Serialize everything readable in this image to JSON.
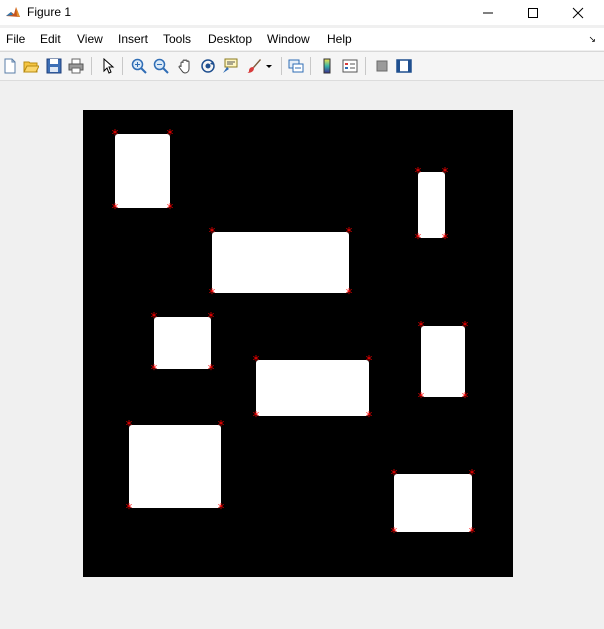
{
  "window": {
    "title": "Figure 1",
    "minimize_glyph": "—",
    "maximize_glyph": "☐",
    "close_glyph": "✕"
  },
  "menu": {
    "items": [
      "File",
      "Edit",
      "View",
      "Insert",
      "Tools",
      "Desktop",
      "Window",
      "Help"
    ],
    "overflow_glyph": "↘"
  },
  "toolbar": {
    "buttons": [
      {
        "name": "new-figure-icon"
      },
      {
        "name": "open-file-icon"
      },
      {
        "name": "save-icon"
      },
      {
        "name": "print-icon"
      },
      {
        "name": "edit-plot-pointer-icon"
      },
      {
        "name": "zoom-in-icon"
      },
      {
        "name": "zoom-out-icon"
      },
      {
        "name": "pan-hand-icon"
      },
      {
        "name": "rotate-3d-icon"
      },
      {
        "name": "data-cursor-icon"
      },
      {
        "name": "brush-icon"
      },
      {
        "name": "link-plot-icon"
      },
      {
        "name": "insert-colorbar-icon"
      },
      {
        "name": "insert-legend-icon"
      },
      {
        "name": "hide-plot-tools-icon"
      },
      {
        "name": "show-plot-tools-icon"
      }
    ]
  },
  "colors": {
    "background": "#000000",
    "rectangle_fill": "#ffffff",
    "corner_marker": "#ff0000"
  },
  "image": {
    "marker_glyph": "*",
    "rectangles": [
      {
        "id": 1,
        "corners": 4
      },
      {
        "id": 2,
        "corners": 4
      },
      {
        "id": 3,
        "corners": 4
      },
      {
        "id": 4,
        "corners": 4
      },
      {
        "id": 5,
        "corners": 4
      },
      {
        "id": 6,
        "corners": 4
      },
      {
        "id": 7,
        "corners": 4
      },
      {
        "id": 8,
        "corners": 4
      }
    ]
  }
}
